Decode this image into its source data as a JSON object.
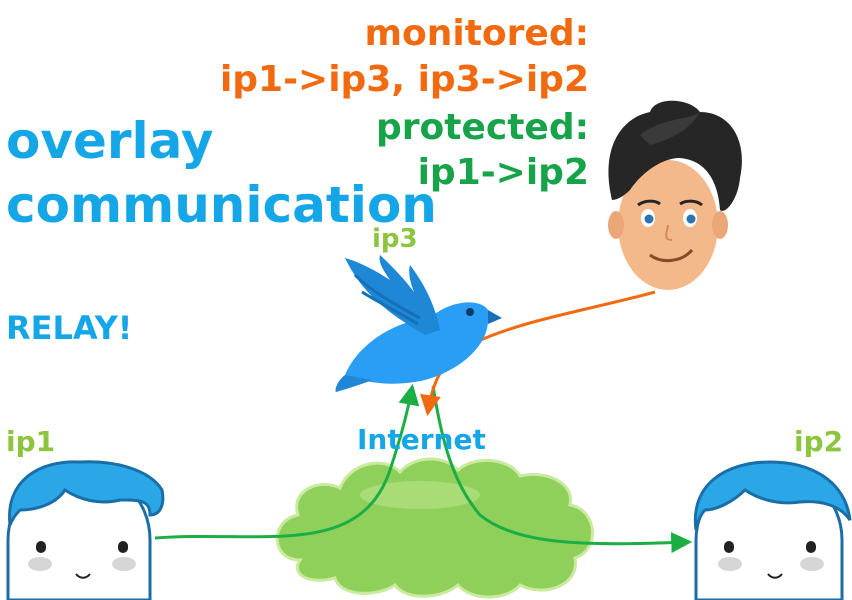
{
  "title": {
    "line1": "overlay",
    "line2": "communication"
  },
  "relay_text": "RELAY!",
  "monitored": {
    "heading": "monitored:",
    "flows": "ip1->ip3, ip3->ip2"
  },
  "protected": {
    "heading": "protected:",
    "flows": "ip1->ip2"
  },
  "nodes": {
    "ip1": "ip1",
    "ip2": "ip2",
    "ip3": "ip3",
    "internet": "Internet"
  },
  "colors": {
    "title_blue": "#14a6e6",
    "monitored_orange": "#f26a0f",
    "protected_green": "#16a34a",
    "node_label_green": "#8cc63f",
    "cloud_green": "#8fd05a",
    "bird_blue": "#2a9df4"
  },
  "icons": [
    "user-ip1-icon",
    "user-ip2-icon",
    "relay-bird-icon",
    "observer-face-icon",
    "internet-cloud-icon"
  ]
}
